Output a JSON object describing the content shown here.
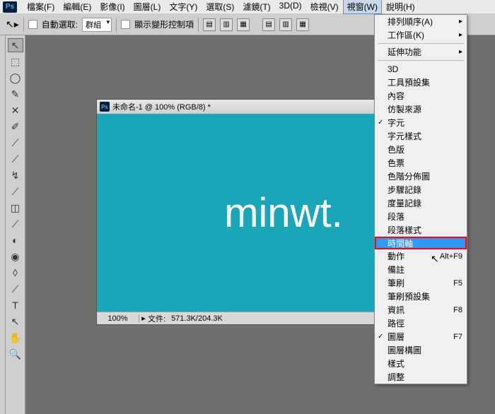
{
  "menubar": {
    "items": [
      "檔案(F)",
      "編輯(E)",
      "影像(I)",
      "圖層(L)",
      "文字(Y)",
      "選取(S)",
      "濾鏡(T)",
      "3D(D)",
      "檢視(V)",
      "視窗(W)",
      "說明(H)"
    ],
    "active_index": 9
  },
  "optbar": {
    "auto_select": "自動選取:",
    "group": "群組",
    "show_transform": "顯示變形控制項"
  },
  "tools": [
    "↖",
    "⬚",
    "◯",
    "✎",
    "✕",
    "✐",
    "⟋",
    "⟋",
    "↯",
    "⟋",
    "◫",
    "⟋",
    "◐",
    "◉",
    "◊",
    "⟋",
    "T",
    "↖",
    "✋",
    "🔍"
  ],
  "document": {
    "title": "未命名-1 @ 100% (RGB/8) *",
    "canvas_text": "minwt.",
    "zoom": "100%",
    "status_label": "文件:",
    "filesize": "571.3K/204.3K"
  },
  "dropdown": {
    "items": [
      {
        "label": "排列順序(A)",
        "type": "submenu"
      },
      {
        "label": "工作區(K)",
        "type": "submenu"
      },
      {
        "type": "sep"
      },
      {
        "label": "延伸功能",
        "type": "submenu"
      },
      {
        "type": "sep"
      },
      {
        "label": "3D"
      },
      {
        "label": "工具預設集"
      },
      {
        "label": "內容"
      },
      {
        "label": "仿製來源"
      },
      {
        "label": "字元",
        "checked": true
      },
      {
        "label": "字元樣式"
      },
      {
        "label": "色版"
      },
      {
        "label": "色票"
      },
      {
        "label": "色階分佈圖"
      },
      {
        "label": "步驟記錄"
      },
      {
        "label": "度量記錄"
      },
      {
        "label": "段落"
      },
      {
        "label": "段落樣式"
      },
      {
        "label": "時間軸",
        "highlight": true
      },
      {
        "label": "動作",
        "shortcut": "Alt+F9"
      },
      {
        "label": "備註"
      },
      {
        "label": "筆刷",
        "shortcut": "F5"
      },
      {
        "label": "筆刷預設集"
      },
      {
        "label": "資訊",
        "shortcut": "F8"
      },
      {
        "label": "路徑"
      },
      {
        "label": "圖層",
        "shortcut": "F7",
        "checked": true
      },
      {
        "label": "圖層構圖"
      },
      {
        "label": "樣式"
      },
      {
        "label": "調整"
      }
    ]
  }
}
